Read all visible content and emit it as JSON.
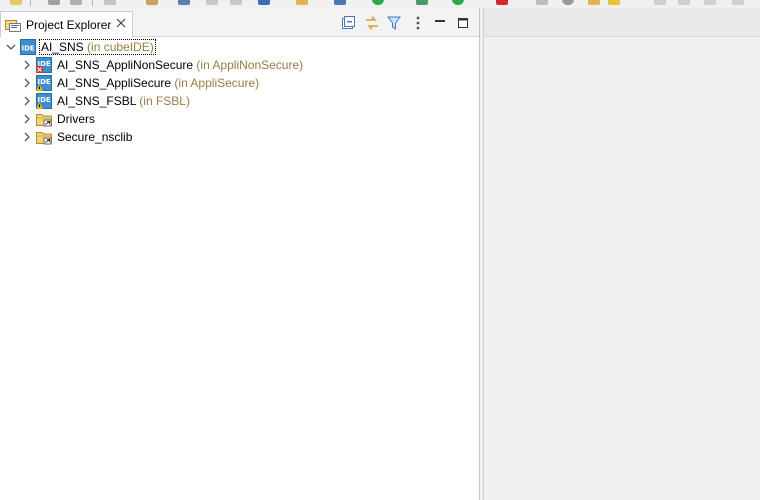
{
  "toolbar": {
    "icons": [
      "new-icon",
      "save-icon",
      "print-icon",
      "settings-icon",
      "hammer-icon",
      "binary-icon",
      "back-icon",
      "forward-icon",
      "save-all-icon",
      "folder-icon",
      "debug-icon",
      "run-icon",
      "refresh-icon",
      "bug-icon",
      "stop-icon",
      "search-icon",
      "gear-icon",
      "open-icon",
      "lightning-icon",
      "window-icon",
      "layout-icon",
      "pin-icon"
    ]
  },
  "view": {
    "tab_label": "Project Explorer",
    "tab_icon": "project-explorer-icon",
    "toolbar_icons": [
      "collapse-all-icon",
      "link-with-editor-icon",
      "filter-icon",
      "view-menu-icon",
      "minimize-icon",
      "maximize-icon"
    ]
  },
  "tree": {
    "items": [
      {
        "name": "AI_SNS",
        "context": "(in cubeIDE)",
        "icon": "ide-project-icon",
        "expanded": true,
        "selected": true
      },
      {
        "name": "AI_SNS_AppliNonSecure",
        "context": "(in AppliNonSecure)",
        "icon": "ide-project-error-icon",
        "expanded": false
      },
      {
        "name": "AI_SNS_AppliSecure",
        "context": "(in AppliSecure)",
        "icon": "ide-project-warning-icon",
        "expanded": false
      },
      {
        "name": "AI_SNS_FSBL",
        "context": "(in FSBL)",
        "icon": "ide-project-warning-icon",
        "expanded": false
      },
      {
        "name": "Drivers",
        "context": "",
        "icon": "linked-folder-icon",
        "expanded": false
      },
      {
        "name": "Secure_nsclib",
        "context": "",
        "icon": "linked-folder-icon",
        "expanded": false
      }
    ]
  },
  "colors": {
    "context_text": "#957d47",
    "ide_icon_blue": "#3b8ed0",
    "error_red": "#d32f2f",
    "warning_yellow": "#e8b400",
    "folder_yellow": "#e9c46a"
  }
}
